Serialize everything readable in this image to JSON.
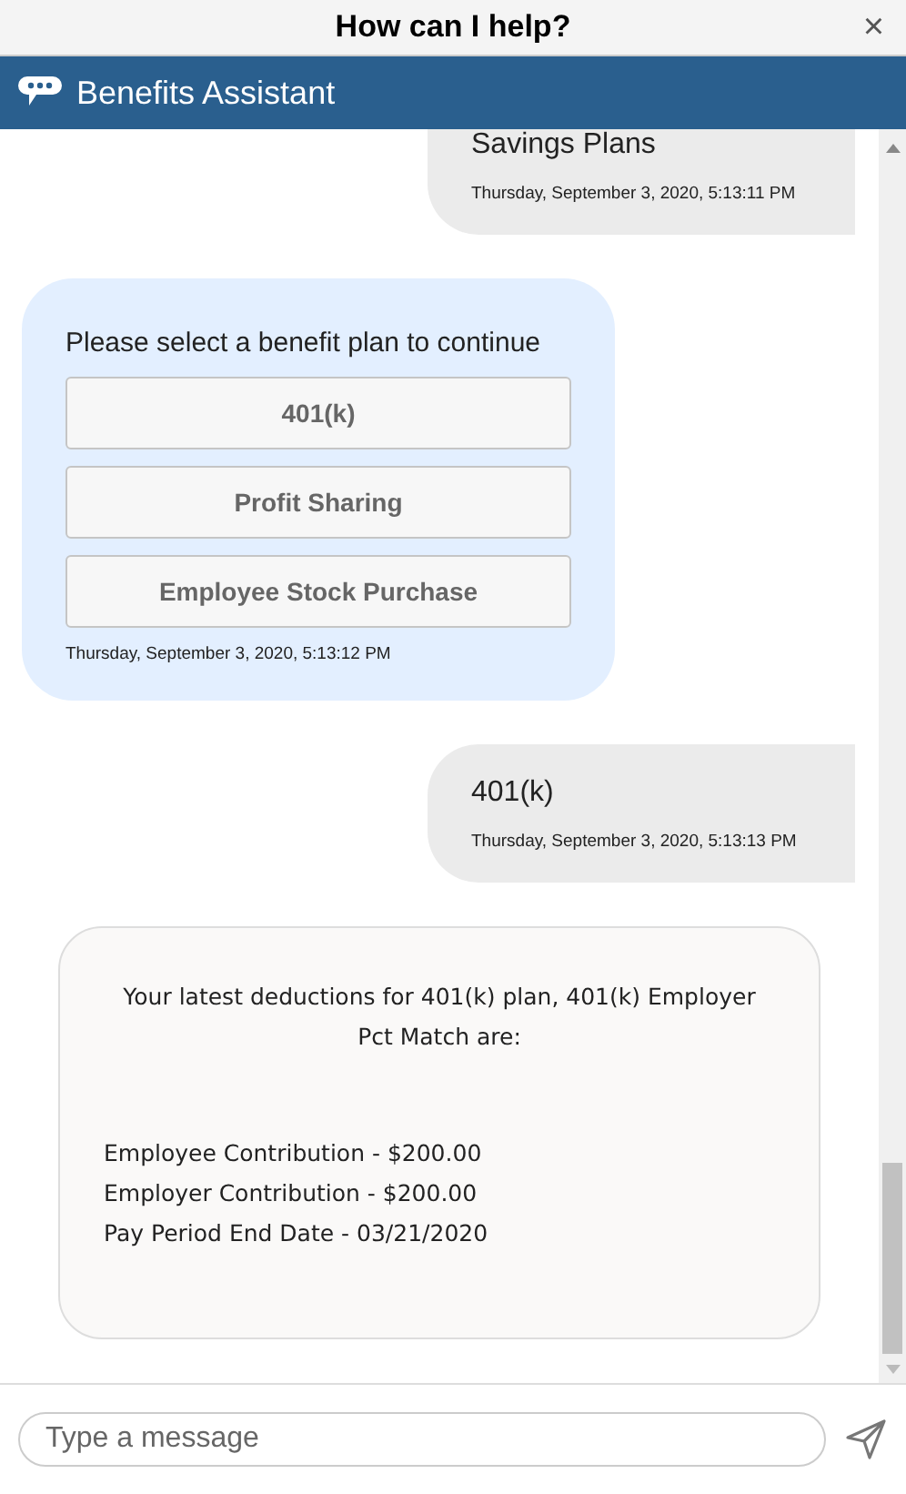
{
  "window": {
    "title": "How can I help?",
    "close": "×"
  },
  "header": {
    "title": "Benefits Assistant"
  },
  "messages": [
    {
      "kind": "user",
      "text": "Savings Plans",
      "time": "Thursday, September 3, 2020, 5:13:11 PM"
    },
    {
      "kind": "options",
      "text": "Please select a benefit plan to continue",
      "options": [
        "401(k)",
        "Profit Sharing",
        "Employee Stock Purchase"
      ],
      "time": "Thursday, September 3, 2020, 5:13:12 PM"
    },
    {
      "kind": "user",
      "text": "401(k)",
      "time": "Thursday, September 3, 2020, 5:13:13 PM"
    },
    {
      "kind": "card",
      "intro": "Your latest deductions for 401(k) plan, 401(k) Employer Pct Match are:",
      "lines": [
        "Employee Contribution - $200.00",
        "Employer Contribution - $200.00",
        "Pay Period End Date - 03/21/2020"
      ]
    }
  ],
  "composer": {
    "placeholder": "Type a message"
  }
}
